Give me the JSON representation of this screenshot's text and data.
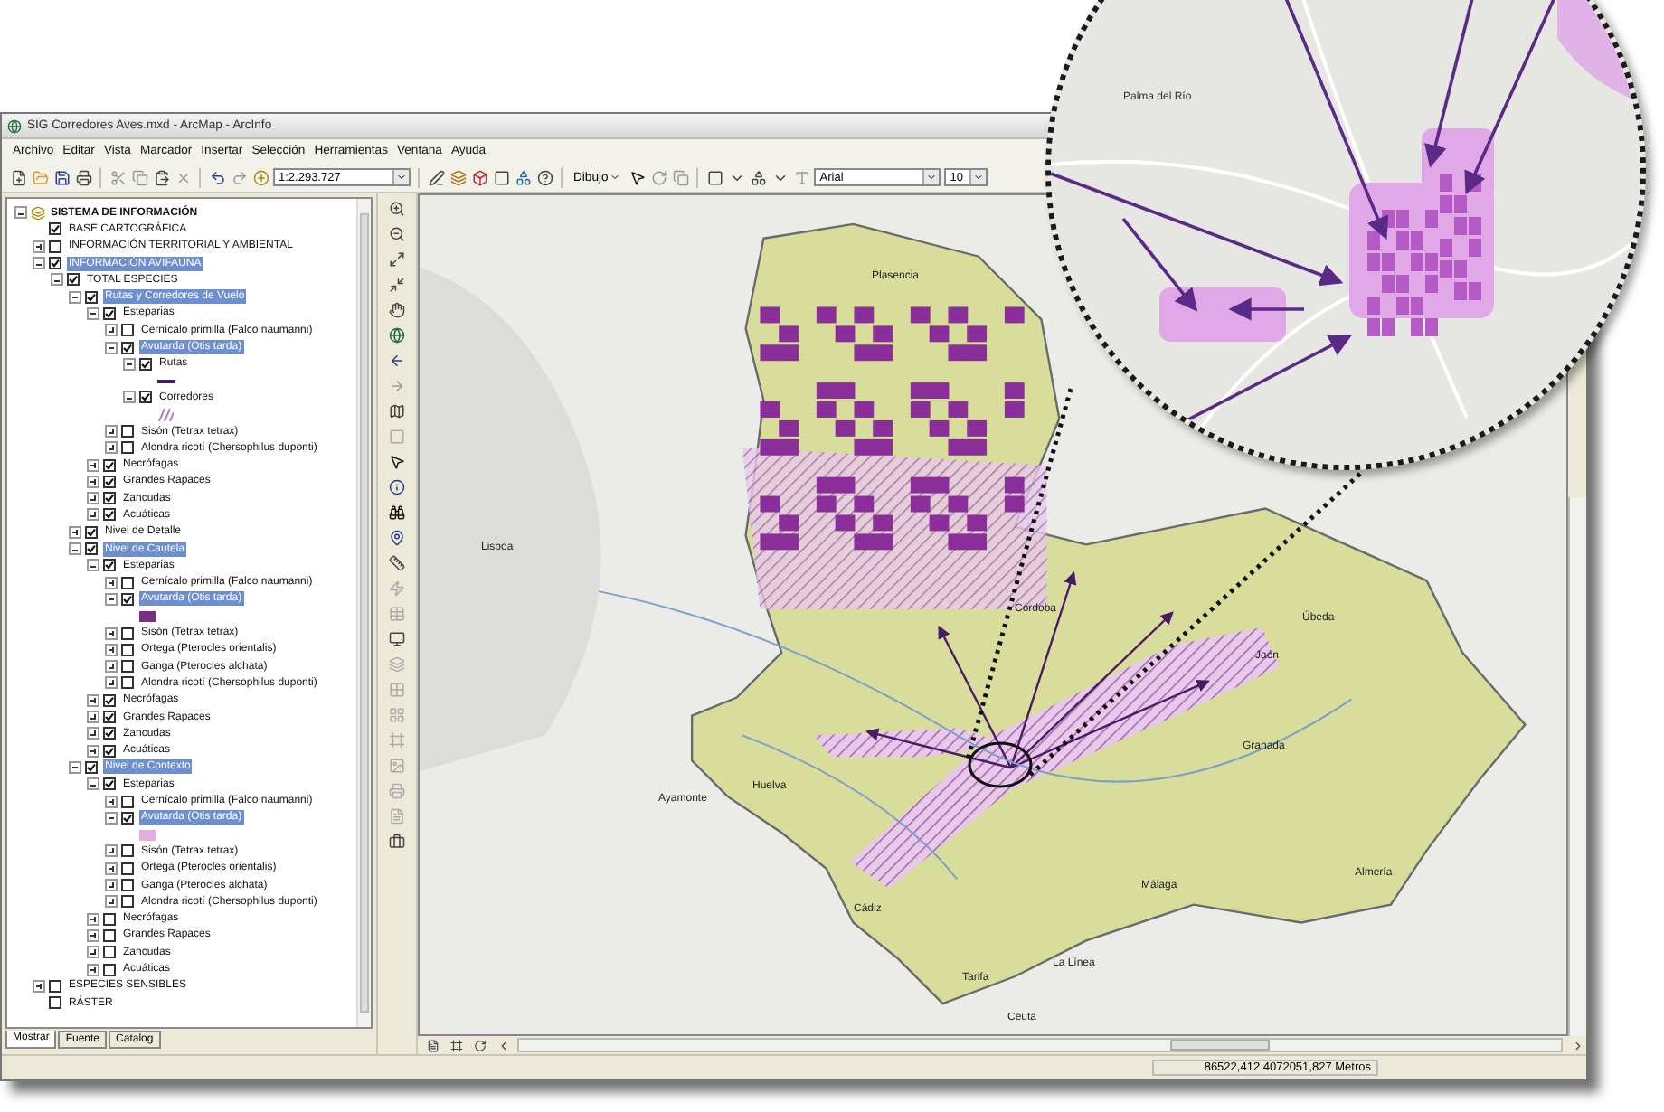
{
  "window": {
    "title": "SIG Corredores Aves.mxd - ArcMap - ArcInfo"
  },
  "menu": [
    "Archivo",
    "Editar",
    "Vista",
    "Marcador",
    "Insertar",
    "Selección",
    "Herramientas",
    "Ventana",
    "Ayuda"
  ],
  "toolbar": {
    "scale": "1:2.293.727",
    "drawing_menu": "Dibujo",
    "font": "Arial",
    "font_size": "10"
  },
  "toc": {
    "root": {
      "label": "SISTEMA DE INFORMACIÓN",
      "expanded": true
    },
    "children": [
      {
        "kind": "layer",
        "label": "BASE CARTOGRÁFICA",
        "checked": true,
        "selected": false
      },
      {
        "kind": "group",
        "label": "INFORMACIÓN TERRITORIAL Y AMBIENTAL",
        "checked": false,
        "expanded": false,
        "selected": false
      },
      {
        "kind": "group",
        "label": "INFORMACIÓN AVIFAUNA",
        "checked": true,
        "expanded": true,
        "selected": true,
        "children": [
          {
            "kind": "group",
            "label": "TOTAL ESPECIES",
            "checked": true,
            "expanded": true,
            "selected": false,
            "children": [
              {
                "kind": "group",
                "label": "Rutas y Corredores de Vuelo",
                "checked": true,
                "expanded": true,
                "selected": true,
                "children": [
                  {
                    "kind": "group",
                    "label": "Esteparias",
                    "checked": true,
                    "expanded": true,
                    "selected": false,
                    "children": [
                      {
                        "kind": "group",
                        "label": "Cernícalo primilla (Falco naumanni)",
                        "checked": false,
                        "expanded": false,
                        "selected": false
                      },
                      {
                        "kind": "group",
                        "label": "Avutarda (Otis tarda)",
                        "checked": true,
                        "expanded": true,
                        "selected": true,
                        "children": [
                          {
                            "kind": "group",
                            "label": "Rutas",
                            "checked": true,
                            "expanded": true,
                            "selected": false,
                            "children": [
                              {
                                "kind": "legend-line",
                                "color": "#4a1a66"
                              }
                            ]
                          },
                          {
                            "kind": "group",
                            "label": "Corredores",
                            "checked": true,
                            "expanded": true,
                            "selected": false,
                            "children": [
                              {
                                "kind": "legend-hatch",
                                "color": "#b07cc6"
                              }
                            ]
                          }
                        ]
                      },
                      {
                        "kind": "group",
                        "label": "Sisón (Tetrax tetrax)",
                        "checked": false,
                        "expanded": false,
                        "selected": false
                      },
                      {
                        "kind": "group",
                        "label": "Alondra ricotí (Chersophilus duponti)",
                        "checked": false,
                        "expanded": false,
                        "selected": false
                      }
                    ]
                  },
                  {
                    "kind": "group",
                    "label": "Necrófagas",
                    "checked": true,
                    "expanded": false,
                    "selected": false
                  },
                  {
                    "kind": "group",
                    "label": "Grandes Rapaces",
                    "checked": true,
                    "expanded": false,
                    "selected": false
                  },
                  {
                    "kind": "group",
                    "label": "Zancudas",
                    "checked": true,
                    "expanded": false,
                    "selected": false
                  },
                  {
                    "kind": "group",
                    "label": "Acuáticas",
                    "checked": true,
                    "expanded": false,
                    "selected": false
                  }
                ]
              },
              {
                "kind": "group",
                "label": "Nivel de Detalle",
                "checked": true,
                "expanded": false,
                "selected": false
              },
              {
                "kind": "group",
                "label": "Nivel de Cautela",
                "checked": true,
                "expanded": true,
                "selected": true,
                "children": [
                  {
                    "kind": "group",
                    "label": "Esteparias",
                    "checked": true,
                    "expanded": true,
                    "selected": false,
                    "children": [
                      {
                        "kind": "group",
                        "label": "Cernícalo primilla (Falco naumanni)",
                        "checked": false,
                        "expanded": false,
                        "selected": false
                      },
                      {
                        "kind": "group",
                        "label": "Avutarda (Otis tarda)",
                        "checked": true,
                        "expanded": true,
                        "selected": true,
                        "children": [
                          {
                            "kind": "legend-fill",
                            "color": "#7a2e86"
                          }
                        ]
                      },
                      {
                        "kind": "group",
                        "label": "Sisón (Tetrax tetrax)",
                        "checked": false,
                        "expanded": false,
                        "selected": false
                      },
                      {
                        "kind": "group",
                        "label": "Ortega (Pterocles orientalis)",
                        "checked": false,
                        "expanded": false,
                        "selected": false
                      },
                      {
                        "kind": "group",
                        "label": "Ganga (Pterocles alchata)",
                        "checked": false,
                        "expanded": false,
                        "selected": false
                      },
                      {
                        "kind": "group",
                        "label": "Alondra ricotí (Chersophilus duponti)",
                        "checked": false,
                        "expanded": false,
                        "selected": false
                      }
                    ]
                  },
                  {
                    "kind": "group",
                    "label": "Necrófagas",
                    "checked": true,
                    "expanded": false,
                    "selected": false
                  },
                  {
                    "kind": "group",
                    "label": "Grandes Rapaces",
                    "checked": true,
                    "expanded": false,
                    "selected": false
                  },
                  {
                    "kind": "group",
                    "label": "Zancudas",
                    "checked": true,
                    "expanded": false,
                    "selected": false
                  },
                  {
                    "kind": "group",
                    "label": "Acuáticas",
                    "checked": true,
                    "expanded": false,
                    "selected": false
                  }
                ]
              },
              {
                "kind": "group",
                "label": "Nivel de Contexto",
                "checked": true,
                "expanded": true,
                "selected": true,
                "children": [
                  {
                    "kind": "group",
                    "label": "Esteparias",
                    "checked": true,
                    "expanded": true,
                    "selected": false,
                    "children": [
                      {
                        "kind": "group",
                        "label": "Cernícalo primilla (Falco naumanni)",
                        "checked": false,
                        "expanded": false,
                        "selected": false
                      },
                      {
                        "kind": "group",
                        "label": "Avutarda (Otis tarda)",
                        "checked": true,
                        "expanded": true,
                        "selected": true,
                        "children": [
                          {
                            "kind": "legend-fill",
                            "color": "#e2aee0"
                          }
                        ]
                      },
                      {
                        "kind": "group",
                        "label": "Sisón (Tetrax tetrax)",
                        "checked": false,
                        "expanded": false,
                        "selected": false
                      },
                      {
                        "kind": "group",
                        "label": "Ortega (Pterocles orientalis)",
                        "checked": false,
                        "expanded": false,
                        "selected": false
                      },
                      {
                        "kind": "group",
                        "label": "Ganga (Pterocles alchata)",
                        "checked": false,
                        "expanded": false,
                        "selected": false
                      },
                      {
                        "kind": "group",
                        "label": "Alondra ricotí (Chersophilus duponti)",
                        "checked": false,
                        "expanded": false,
                        "selected": false
                      }
                    ]
                  },
                  {
                    "kind": "group",
                    "label": "Necrófagas",
                    "checked": false,
                    "expanded": false,
                    "selected": false
                  },
                  {
                    "kind": "group",
                    "label": "Grandes Rapaces",
                    "checked": false,
                    "expanded": false,
                    "selected": false
                  },
                  {
                    "kind": "group",
                    "label": "Zancudas",
                    "checked": false,
                    "expanded": false,
                    "selected": false
                  },
                  {
                    "kind": "group",
                    "label": "Acuáticas",
                    "checked": false,
                    "expanded": false,
                    "selected": false
                  }
                ]
              }
            ]
          }
        ]
      },
      {
        "kind": "group",
        "label": "ESPECIES SENSIBLES",
        "checked": false,
        "expanded": false,
        "selected": false
      },
      {
        "kind": "layer",
        "label": "RÁSTER",
        "checked": false,
        "selected": false
      }
    ],
    "tabs": [
      {
        "label": "Mostrar",
        "selected": true
      },
      {
        "label": "Fuente",
        "selected": false
      },
      {
        "label": "Catalog",
        "selected": false
      }
    ]
  },
  "map": {
    "labels": [
      "Plasencia",
      "Lisboa",
      "Córdoba",
      "Úbeda",
      "Jaén",
      "Granada",
      "Huelva",
      "Ayamonte",
      "Cádiz",
      "Málaga",
      "Almería",
      "La Línea",
      "Tarifa",
      "Ceuta"
    ],
    "magnifier_labels": [
      "Palma del Río"
    ]
  },
  "status_bar": {
    "coordinates": "86522,412  4072051,827 Metros"
  }
}
